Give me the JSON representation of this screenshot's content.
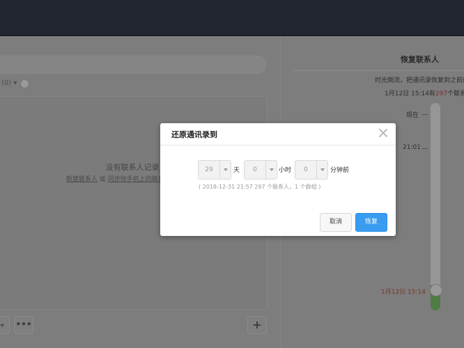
{
  "left_panel": {
    "filter_label": "(0)",
    "empty_title": "没有联系人记录",
    "empty_link_new": "新建联系人",
    "empty_link_or": "或",
    "empty_link_sync": "同步你手机上的联系",
    "more_label": "•••",
    "add_label": "+",
    "nav_label": "→"
  },
  "right_panel": {
    "title": "恢复联系人",
    "description": "时光倒流，把通讯录恢复到之前的时",
    "count_prefix": "1月12日 15:14有",
    "count_number": "297",
    "count_suffix": "个联系人，",
    "timeline": {
      "now_label": "现在",
      "mid_label": "21:01",
      "start_label": "1月12日 15:14",
      "selected_position_fraction": 0.0
    }
  },
  "modal": {
    "title": "还原通讯录到",
    "days": {
      "value": "29",
      "unit": "天"
    },
    "hours": {
      "value": "0",
      "unit": "小时"
    },
    "minutes": {
      "value": "0",
      "unit": "分钟前"
    },
    "summary": "( 2018-12-31 21:57 297 个联系人，1 个群组 )",
    "cancel_label": "取消",
    "restore_label": "恢复"
  },
  "colors": {
    "accent": "#3a9cf0",
    "topbar": "#22262e",
    "timeline_fill": "#4f7b44"
  },
  "icons": {
    "close": "close-icon",
    "dropdown": "chevron-down-icon",
    "filter": "filter-icon"
  }
}
